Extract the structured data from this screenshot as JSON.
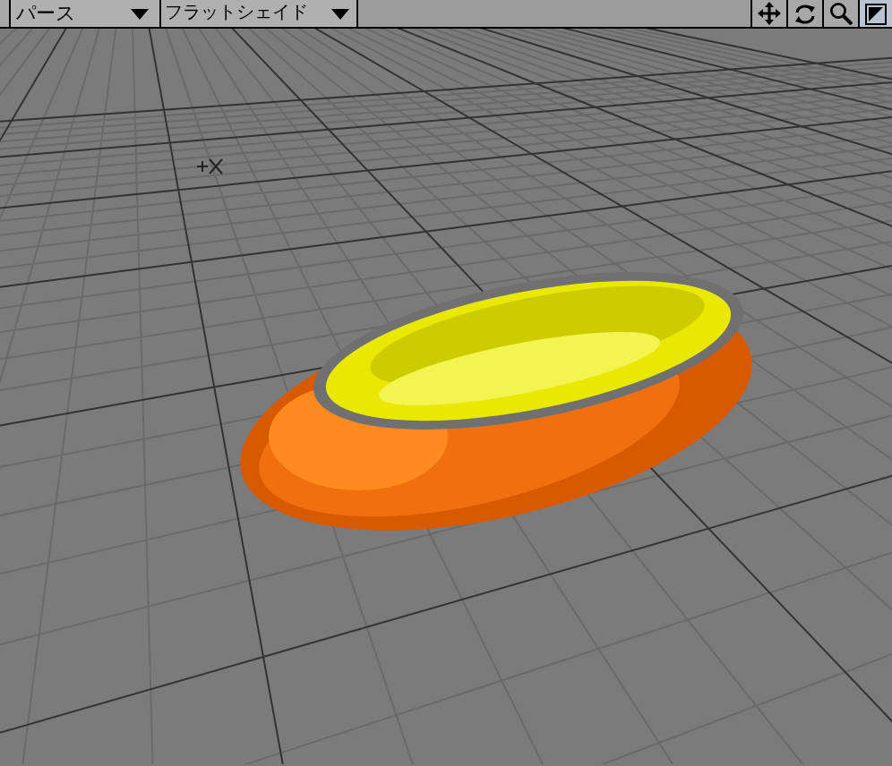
{
  "toolbar": {
    "view_dropdown": {
      "label": "パース"
    },
    "shading_dropdown": {
      "label": "フラットシェイド"
    }
  }
}
